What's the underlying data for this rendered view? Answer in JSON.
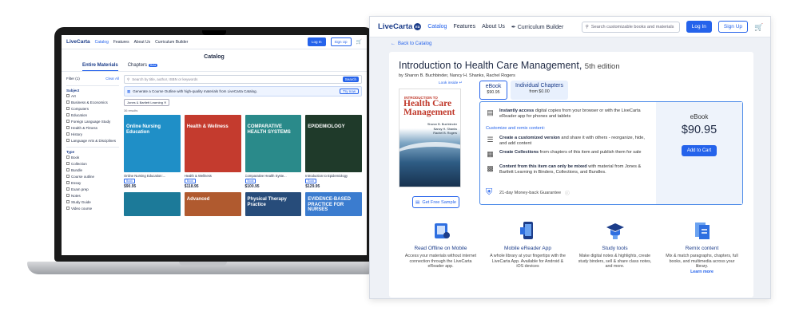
{
  "laptop": {
    "logo": "LiveCarta",
    "nav": [
      "Catalog",
      "Features",
      "About Us",
      "Curriculum Builder"
    ],
    "login": "Log In",
    "signup": "Sign Up",
    "title": "Catalog",
    "tabs": {
      "materials": "Entire Materials",
      "chapters": "Chapters",
      "beta": "Beta"
    },
    "filter_label": "Filter (1)",
    "clear_all": "Clear All",
    "subject_header": "Subject",
    "subjects": [
      "Art",
      "Business & Economics",
      "Computers",
      "Education",
      "Foreign Language Study",
      "Health & Fitness",
      "History",
      "Language Arts & Disciplines"
    ],
    "type_header": "Type",
    "types": [
      "Book",
      "Collection",
      "Bundle",
      "Course outline",
      "Essay",
      "Exam prep",
      "Notes",
      "Study Guide",
      "Video course"
    ],
    "search_placeholder": "Search by title, author, ISBN or keywords",
    "search_btn": "Search",
    "banner_text": "Generate a Course Outline with high-quality materials from LiveCarta Catalog.",
    "banner_btn": "Try now",
    "chip": "Jones & Bartlett Learning",
    "results": "36 results",
    "books": [
      {
        "cover": "Online Nursing Education",
        "title": "Online Nursing Education:...",
        "tag": "Book",
        "price": "$90.95",
        "color": "#1f8fc7"
      },
      {
        "cover": "Health & Wellness",
        "title": "Health & Wellness",
        "tag": "Book",
        "price": "$118.95",
        "color": "#c43b2e"
      },
      {
        "cover": "COMPARATIVE HEALTH SYSTEMS",
        "title": "Comparative Health Syste...",
        "tag": "Book",
        "price": "$100.95",
        "color": "#2a8a8a"
      },
      {
        "cover": "EPIDEMIOLOGY",
        "title": "Introduction to Epidemiology",
        "tag": "Book",
        "price": "$129.95",
        "color": "#1f3a2a"
      }
    ],
    "row2": [
      {
        "cover": "",
        "color": "#1c7a99"
      },
      {
        "cover": "Advanced",
        "color": "#b05a2f"
      },
      {
        "cover": "Physical Therapy Practice",
        "color": "#274c7a"
      },
      {
        "cover": "EVIDENCE-BASED PRACTICE FOR NURSES",
        "color": "#3b7ccf"
      }
    ]
  },
  "page": {
    "logo": "LiveCarta",
    "logo_badge": "ED",
    "nav": [
      "Catalog",
      "Features",
      "About Us",
      "Curriculum Builder"
    ],
    "search_placeholder": "Search customizable books and materials",
    "login": "Log In",
    "signup": "Sign Up",
    "back": "Back to Catalog",
    "title": "Introduction to Health Care Management,",
    "edition": "5th edition",
    "authors": "by Sharon B. Buchbinder, Nancy H. Shanks, Rachel Rogers",
    "look_inside": "Look inside",
    "cover": {
      "small": "INTRODUCTION TO",
      "big": "Health Care Management",
      "authors": "Sharon B. Buchbinder\nNancy H. Shanks\nRachel B. Rogers"
    },
    "free_sample": "Get Free Sample",
    "formats": [
      {
        "label": "eBook",
        "price": "$90.95"
      },
      {
        "label": "Individual Chapters",
        "price": "from $0.00"
      }
    ],
    "features": [
      {
        "bold": "Instantly access",
        "text": " digital copies from your browser or with the LiveCarta eReader app for phones and tablets"
      },
      {
        "bold": "Create a customized version",
        "text": " and share it with others - reorganize, hide, and add content"
      },
      {
        "bold": "Create Collections",
        "text": " from chapters of this item and publish them for sale"
      },
      {
        "bold": "Content from this item can only be mixed",
        "text": " with material from Jones & Bartlett Learning in Binders, Collections, and Bundles."
      }
    ],
    "customize_header": "Customize and remix content:",
    "guarantee": "21-day Money-back Guarantee",
    "price_label": "eBook",
    "price": "$90.95",
    "add_to_cart": "Add to Cart",
    "benefits": [
      {
        "title": "Read Offline on Mobile",
        "text": "Access your materials without internet connection through the LiveCarta eReader app."
      },
      {
        "title": "Mobile eReader App",
        "text": "A whole library at your fingertips with the LiveCarta App. Available for Android & iOS devices"
      },
      {
        "title": "Study tools",
        "text": "Make digital notes & highlights, create study binders, sell & share class notes, and more."
      },
      {
        "title": "Remix content",
        "text": "Mix & match paragraphs, chapters, full books, and multimedia across your library.",
        "more": "Learn more"
      }
    ]
  },
  "colors": {
    "brand": "#1c3d8a",
    "accent": "#2563eb"
  }
}
